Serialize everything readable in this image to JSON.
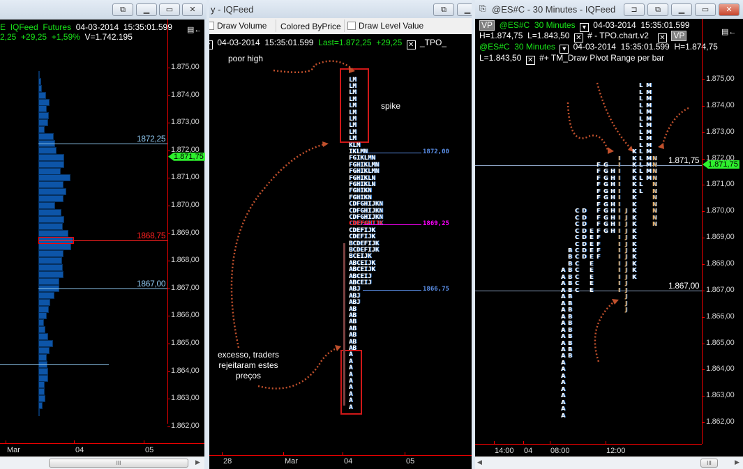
{
  "left_window": {
    "header_line1": {
      "prefix": "E",
      "feed": "IQFeed",
      "type": "Futures",
      "date": "04-03-2014",
      "time": "15:35:01.599"
    },
    "header_line2": {
      "last": "2,25",
      "change": "+29,25",
      "pct": "+1,59%",
      "volume": "V=1.742.195"
    },
    "price_axis": [
      "1.875,00",
      "1.874,00",
      "1.873,00",
      "1.872,00",
      "1.871,00",
      "1.870,00",
      "1.869,00",
      "1.868,00",
      "1.867,00",
      "1.866,00",
      "1.865,00",
      "1.864,00",
      "1.863,00",
      "1.862,00"
    ],
    "current_price_tag": "1.871,75",
    "levels": [
      {
        "price": 1872.25,
        "label": "1872,25",
        "color": "#8fc8f0"
      },
      {
        "price": 1868.75,
        "label": "1868,75",
        "color": "#ff2020"
      },
      {
        "price": 1867.0,
        "label": "1867,00",
        "color": "#8fc8f0"
      }
    ],
    "profile_top_price": 1874.75,
    "profile_volumes": [
      1,
      4,
      5,
      11,
      16,
      12,
      15,
      14,
      9,
      22,
      24,
      26,
      37,
      37,
      32,
      46,
      36,
      40,
      36,
      24,
      33,
      37,
      35,
      43,
      50,
      47,
      36,
      34,
      35,
      36,
      30,
      30,
      23,
      17,
      15,
      12,
      8,
      10,
      14,
      21,
      16,
      12,
      13,
      14,
      14,
      9,
      9,
      10,
      6,
      2
    ],
    "x_axis": [
      "Mar",
      "04",
      "05"
    ]
  },
  "middle_window": {
    "title": "y - IQFeed",
    "toolbar": {
      "draw_volume": "Draw Volume",
      "colored_by_price": "Colored ByPrice",
      "draw_level_value": "Draw Level Value"
    },
    "header": {
      "date": "04-03-2014",
      "time": "15:35:01.599",
      "last": "Last=1.872,25",
      "change": "+29,25",
      "indicator": "_TPO_"
    },
    "tpo_top_price": 1874.75,
    "tpo_rows": [
      "LM",
      "LM",
      "LM",
      "LM",
      "LM",
      "LM",
      "LM",
      "LM",
      "LM",
      "LM",
      "KLM",
      "IKLMN",
      "FGIKLMN",
      "FGHIKLMN",
      "FGHIKLMN",
      "FGHIKLN",
      "FGHIKLN",
      "FGHIKN",
      "FGHIKN",
      "CDFGHIJKN",
      "CDFGHIJKN",
      "CDFGHIJKN",
      "CDEFGHIJK",
      "CDEFIJK",
      "CDEFIJK",
      "BCDEFIJK",
      "BCDEFIJK",
      "BCEIJK",
      "ABCEIJK",
      "ABCEIJK",
      "ABCEIJ",
      "ABCEIJ",
      "ABJ",
      "ABJ",
      "ABJ",
      "AB",
      "AB",
      "AB",
      "AB",
      "AB",
      "AB",
      "AB",
      "A",
      "A",
      "A",
      "A",
      "A",
      "A",
      "A",
      "A",
      "A"
    ],
    "poc_row_color": "#ff2020",
    "levels": [
      {
        "price": 1872.0,
        "label": "1872,00",
        "color": "#5b8fe8"
      },
      {
        "price": 1869.25,
        "label": "1869,25",
        "color": "#ff00ff"
      },
      {
        "price": 1866.75,
        "label": "1866,75",
        "color": "#5b8fe8"
      }
    ],
    "annotations": {
      "poor_high": "poor high",
      "spike": "spike",
      "excess": [
        "excesso, traders",
        "rejeitaram estes",
        "preços"
      ]
    },
    "x_axis": [
      "28",
      "Mar",
      "04",
      "05"
    ]
  },
  "right_window": {
    "title": "@ES#C - 30 Minutes - IQFeed",
    "header": {
      "vp": "VP",
      "symbol": "@ES#C",
      "interval": "30 Minutes",
      "date": "04-03-2014",
      "time": "15:35:01.599",
      "high": "H=1.874,75",
      "low": "L=1.843,50",
      "indicator1": "# - TPO.chart.v2",
      "indicator2": "#+ TM_Draw Pivot Range per bar"
    },
    "price_axis": [
      "1.875,00",
      "1.874,00",
      "1.873,00",
      "1.872,00",
      "1.871,00",
      "1.870,00",
      "1.869,00",
      "1.868,00",
      "1.867,00",
      "1.866,00",
      "1.865,00",
      "1.864,00",
      "1.863,00",
      "1.862,00"
    ],
    "current_price_tag": "1.871,75",
    "levels": [
      {
        "price": 1871.75,
        "label": "1.871,75"
      },
      {
        "price": 1867.0,
        "label": "1.867,00"
      }
    ],
    "tpo_columns": [
      {
        "letter": "A",
        "high": 1867.75,
        "low": 1862.25,
        "color": "#ffffff"
      },
      {
        "letter": "B",
        "high": 1868.5,
        "low": 1864.5,
        "color": "#ffffff"
      },
      {
        "letter": "C",
        "high": 1870.0,
        "low": 1867.0,
        "color": "#ffffff"
      },
      {
        "letter": "D",
        "high": 1870.0,
        "low": 1868.25,
        "color": "#ffffff"
      },
      {
        "letter": "E",
        "high": 1869.25,
        "low": 1867.0,
        "color": "#ffffff"
      },
      {
        "letter": "F",
        "high": 1871.75,
        "low": 1868.25,
        "color": "#ffffff"
      },
      {
        "letter": "G",
        "high": 1871.75,
        "low": 1869.25,
        "color": "#ffffff"
      },
      {
        "letter": "H",
        "high": 1871.5,
        "low": 1869.25,
        "color": "#ffffff"
      },
      {
        "letter": "I",
        "high": 1872.0,
        "low": 1867.0,
        "color": "#f0b060"
      },
      {
        "letter": "J",
        "high": 1870.0,
        "low": 1866.25,
        "color": "#f0b060"
      },
      {
        "letter": "K",
        "high": 1872.25,
        "low": 1867.5,
        "color": "#ffffff"
      },
      {
        "letter": "L",
        "high": 1874.75,
        "low": 1870.75,
        "color": "#ffffff"
      },
      {
        "letter": "M",
        "high": 1874.75,
        "low": 1871.25,
        "color": "#ffffff"
      },
      {
        "letter": "N",
        "high": 1872.0,
        "low": 1869.5,
        "color": "#f0b060"
      }
    ],
    "x_axis": [
      "14:00",
      "04",
      "08:00",
      "12:00"
    ]
  }
}
